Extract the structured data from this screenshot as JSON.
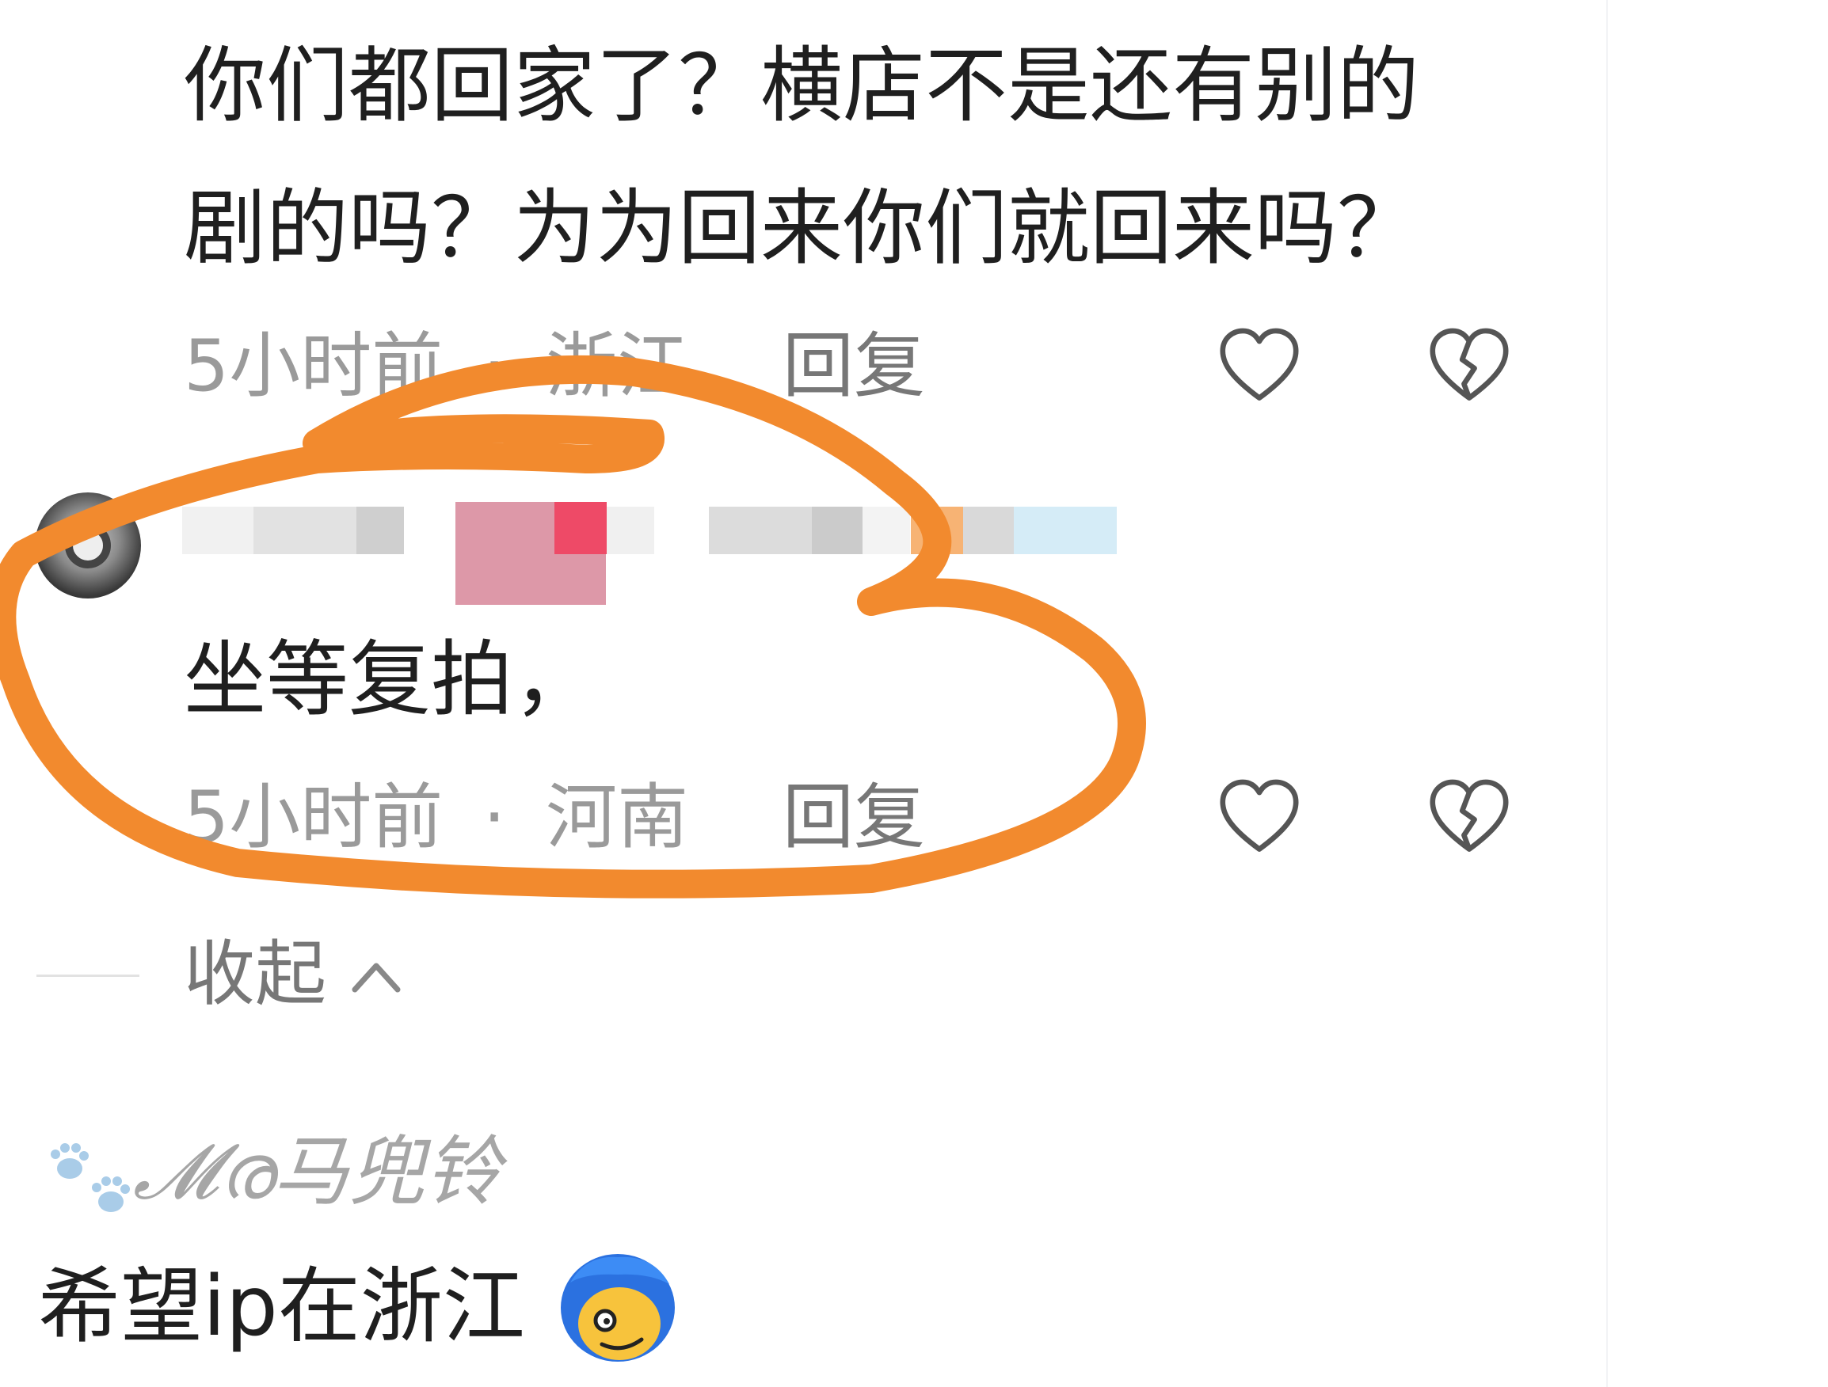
{
  "comment1": {
    "line1": "你们都回家了？横店不是还有别的",
    "line2": "剧的吗？为为回来你们就回来吗？",
    "time": "5小时前",
    "dot": "·",
    "location": "浙江",
    "reply_label": "回复"
  },
  "comment2": {
    "text": "坐等复拍，",
    "time": "5小时前",
    "dot": "·",
    "location": "河南",
    "reply_label": "回复"
  },
  "collapse": {
    "label": "收起"
  },
  "comment3": {
    "username": "𝓜ര马兜铃",
    "text": "希望ip在浙江"
  },
  "icons": {
    "like": "heart-outline-icon",
    "dislike": "broken-heart-icon",
    "collapse": "chevron-up-icon"
  },
  "colors": {
    "annotation": "#f28a2e",
    "meta_text": "#9a9a9a",
    "body_text": "#1f1f1f"
  }
}
